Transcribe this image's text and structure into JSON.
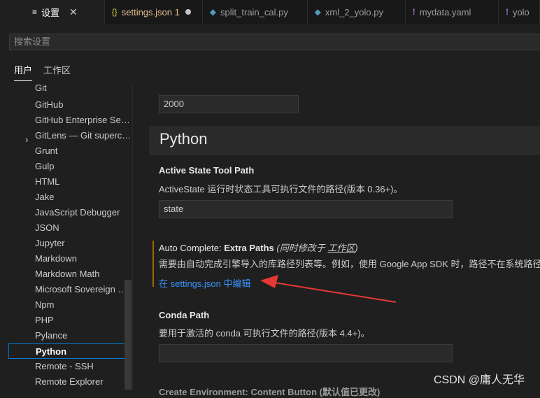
{
  "tabs": [
    {
      "label": "设置",
      "icon": "≡",
      "active": true
    },
    {
      "label": "settings.json 1",
      "icon": "{}"
    },
    {
      "label": "split_train_cal.py",
      "icon": "◆"
    },
    {
      "label": "xml_2_yolo.py",
      "icon": "◆"
    },
    {
      "label": "mydata.yaml",
      "icon": "!"
    },
    {
      "label": "yolo",
      "icon": "!"
    }
  ],
  "search": {
    "placeholder": "搜索设置"
  },
  "scopes": {
    "user": "用户",
    "workspace": "工作区"
  },
  "sidebar": {
    "items": [
      "Git",
      "GitHub",
      "GitHub Enterprise Server",
      "GitLens — Git supercharged",
      "Grunt",
      "Gulp",
      "HTML",
      "Jake",
      "JavaScript Debugger",
      "JSON",
      "Jupyter",
      "Markdown",
      "Markdown Math",
      "Microsoft Sovereign Cloud",
      "Npm",
      "PHP",
      "Pylance",
      "Python",
      "Remote - SSH",
      "Remote Explorer"
    ],
    "selected": "Python"
  },
  "content": {
    "top_value": "2000",
    "section_title": "Python",
    "active_state": {
      "label": "Active State Tool Path",
      "desc": "ActiveState 运行时状态工具可执行文件的路径(版本 0.36+)。",
      "value": "state"
    },
    "auto_complete": {
      "label_prefix": "Auto Complete: ",
      "label_bold": "Extra Paths",
      "modified_prefix": "(同时修改于 ",
      "modified_link": "工作区",
      "modified_suffix": ")",
      "desc": "需要由自动完成引擎导入的库路径列表等。例如，使用 Google App SDK 时，路径不在系统路径中",
      "edit_link": "在 settings.json 中编辑"
    },
    "conda": {
      "label": "Conda Path",
      "desc": "要用于激活的 conda 可执行文件的路径(版本 4.4+)。",
      "value": ""
    },
    "next_label": "Create Environment: Content Button (默认值已更改)"
  },
  "watermark": "CSDN @庸人无华",
  "colors": {
    "accent": "#0078d4",
    "link": "#3794ff",
    "arrow": "#e53935",
    "modified": "#9e6a03"
  }
}
